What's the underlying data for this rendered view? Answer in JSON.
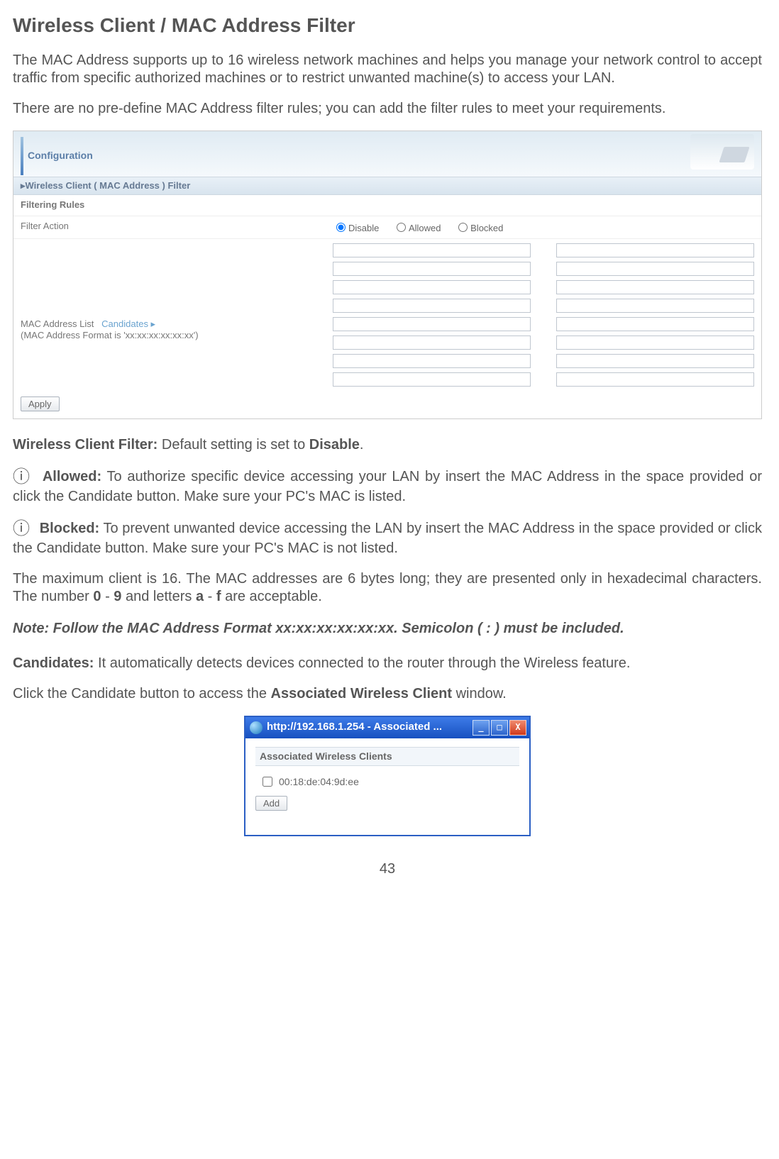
{
  "title": "Wireless Client / MAC Address Filter",
  "intro1": "The MAC Address supports up to 16 wireless network machines and helps you manage your network control to accept traffic from specific authorized machines or to restrict unwanted machine(s) to access your LAN.",
  "intro2": "There are no pre-define MAC Address filter rules; you can add the filter rules to meet your requirements.",
  "ss": {
    "config_label": "Configuration",
    "panel_title": "▸Wireless Client ( MAC Address ) Filter",
    "filtering_rules": "Filtering Rules",
    "filter_action_label": "Filter Action",
    "radio_disable": "Disable",
    "radio_allowed": "Allowed",
    "radio_blocked": "Blocked",
    "mac_list_label": "MAC Address List",
    "candidates_link": "Candidates ▸",
    "mac_format_hint": "(MAC Address Format is 'xx:xx:xx:xx:xx:xx')",
    "apply_button": "Apply"
  },
  "wcf_line_prefix": "Wireless Client Filter:",
  "wcf_line_mid": " Default setting is set to ",
  "wcf_line_bold": "Disable",
  "wcf_line_end": ".",
  "allowed_b": "Allowed:",
  "allowed_txt": " To authorize specific device accessing your LAN by insert the MAC Address in the space provided or click the Candidate button.  Make sure your PC's MAC is listed.",
  "blocked_b": "Blocked:",
  "blocked_txt": " To prevent unwanted device accessing the LAN by insert the MAC Address in the space provided or click the Candidate button. Make sure your PC's MAC is not listed.",
  "max_line_a": "The maximum client is 16.  The MAC addresses are 6 bytes long; they are presented only in hexadecimal characters.  The number ",
  "max_b1": "0",
  "max_dash1": " - ",
  "max_b2": "9",
  "max_mid": " and letters ",
  "max_b3": "a",
  "max_dash2": " - ",
  "max_b4": "f",
  "max_end": " are acceptable.",
  "note_text": "Note:  Follow the MAC Address Format xx:xx:xx:xx:xx:xx.  Semicolon ( : ) must be included.",
  "cand_b": "Candidates:",
  "cand_txt": "   It automatically detects devices connected to the router through the Wireless feature.",
  "click_line_a": "Click the Candidate button to access the ",
  "click_line_b": "Associated Wireless Client",
  "click_line_c": " window.",
  "popup": {
    "title": "http://192.168.1.254 - Associated ...",
    "section": "Associated Wireless Clients",
    "mac": "00:18:de:04:9d:ee",
    "add": "Add"
  },
  "info_icon": "ⓘ",
  "min_icon": "_",
  "max_icon": "□",
  "close_icon": "X",
  "page_number": "43"
}
